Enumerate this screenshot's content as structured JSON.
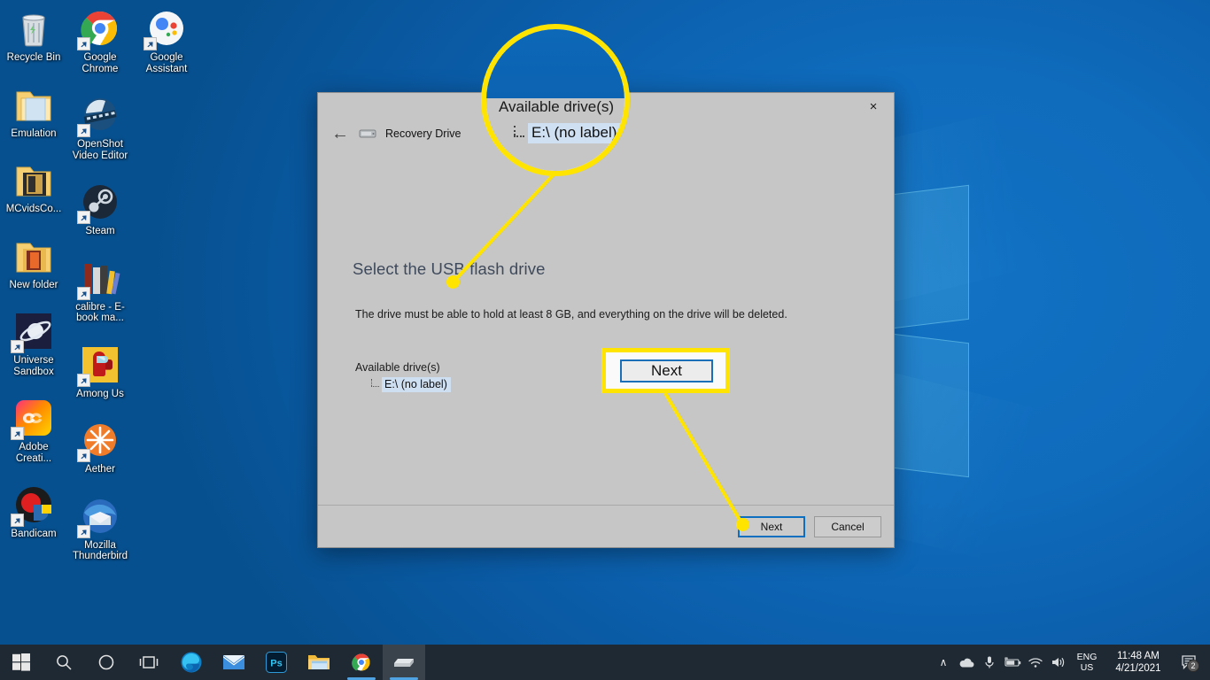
{
  "desktop": {
    "icons": [
      {
        "label": "Recycle Bin",
        "icon": "recycle-bin-icon",
        "shortcut": false
      },
      {
        "label": "Google Chrome",
        "icon": "google-chrome-icon",
        "shortcut": true
      },
      {
        "label": "Google Assistant",
        "icon": "google-assistant-icon",
        "shortcut": true
      },
      {
        "label": "Emulation",
        "icon": "folder-icon",
        "shortcut": false
      },
      {
        "label": "OpenShot Video Editor",
        "icon": "openshot-icon",
        "shortcut": true
      },
      {
        "label": "MCvidsCo...",
        "icon": "folder-icon",
        "shortcut": false
      },
      {
        "label": "Steam",
        "icon": "steam-icon",
        "shortcut": true
      },
      {
        "label": "New folder",
        "icon": "folder-icon",
        "shortcut": false
      },
      {
        "label": "calibre - E-book ma...",
        "icon": "calibre-icon",
        "shortcut": true
      },
      {
        "label": "Universe Sandbox",
        "icon": "universe-sandbox-icon",
        "shortcut": true
      },
      {
        "label": "Among Us",
        "icon": "among-us-icon",
        "shortcut": true
      },
      {
        "label": "Adobe Creati...",
        "icon": "adobe-creative-cloud-icon",
        "shortcut": true
      },
      {
        "label": "Aether",
        "icon": "aether-icon",
        "shortcut": true
      },
      {
        "label": "Bandicam",
        "icon": "bandicam-icon",
        "shortcut": true
      },
      {
        "label": "Mozilla Thunderbird",
        "icon": "thunderbird-icon",
        "shortcut": true
      }
    ]
  },
  "dialog": {
    "title": "Recovery Drive",
    "close_label": "×",
    "back_label": "←",
    "heading": "Select the USB flash drive",
    "description": "The drive must be able to hold at least 8 GB, and everything on the drive will be deleted.",
    "drive_group_label": "Available drive(s)",
    "drive_item": "E:\\ (no label)",
    "buttons": {
      "next": "Next",
      "cancel": "Cancel"
    }
  },
  "annotations": {
    "magnifier": {
      "group_label": "Available drive(s)",
      "drive_item": "E:\\ (no label)"
    },
    "next_callout": {
      "label": "Next"
    },
    "highlight_color": "#ffe400"
  },
  "taskbar": {
    "items": [
      {
        "name": "start-button",
        "icon": "windows-logo-icon"
      },
      {
        "name": "search-button",
        "icon": "search-icon"
      },
      {
        "name": "cortana-button",
        "icon": "cortana-icon"
      },
      {
        "name": "task-view-button",
        "icon": "task-view-icon"
      },
      {
        "name": "edge-button",
        "icon": "microsoft-edge-icon"
      },
      {
        "name": "mail-button",
        "icon": "mail-icon"
      },
      {
        "name": "photoshop-button",
        "icon": "photoshop-icon",
        "label": "Ps"
      },
      {
        "name": "file-explorer-button",
        "icon": "file-explorer-icon"
      },
      {
        "name": "chrome-button",
        "icon": "google-chrome-icon"
      },
      {
        "name": "recovery-drive-button",
        "icon": "drive-icon",
        "active": true
      }
    ],
    "tray": {
      "show_hidden": "∧",
      "icons": [
        "onedrive-icon",
        "microphone-icon",
        "battery-icon",
        "wifi-icon",
        "volume-icon"
      ],
      "language_top": "ENG",
      "language_bottom": "US",
      "time": "11:48 AM",
      "date": "4/21/2021",
      "notification_count": "2"
    }
  }
}
